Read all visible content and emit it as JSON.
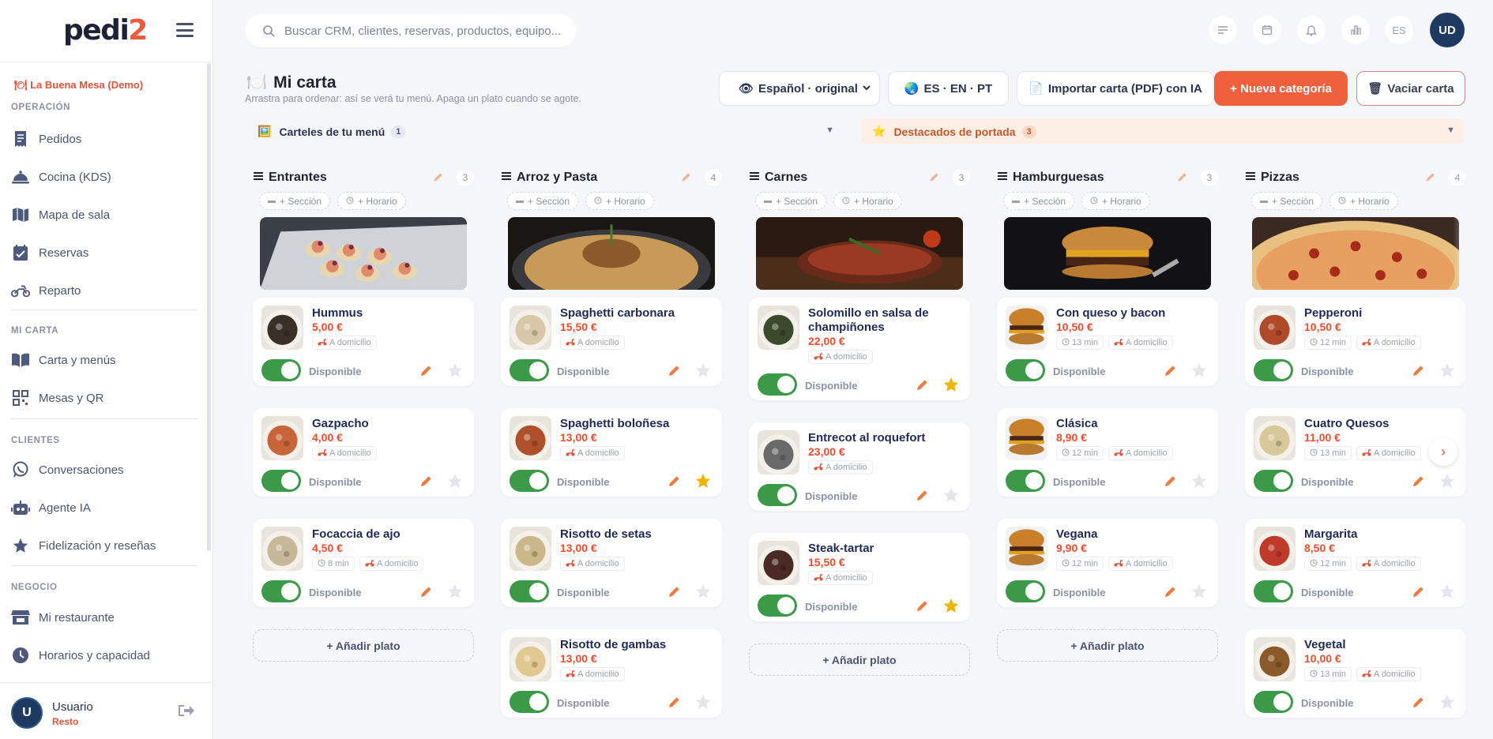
{
  "app": {
    "logo_main": "pedi",
    "logo_accent": "2"
  },
  "sidebar": {
    "brand": "La Buena Mesa (Demo)",
    "sections": [
      {
        "title": "OPERACIÓN",
        "items": [
          {
            "label": "Pedidos",
            "icon": "receipt-icon"
          },
          {
            "label": "Cocina (KDS)",
            "icon": "cloche-icon"
          },
          {
            "label": "Mapa de sala",
            "icon": "map-icon"
          },
          {
            "label": "Reservas",
            "icon": "calendar-check-icon"
          },
          {
            "label": "Reparto",
            "icon": "motorcycle-icon"
          }
        ]
      },
      {
        "title": "MI CARTA",
        "items": [
          {
            "label": "Carta y menús",
            "icon": "book-open-icon"
          },
          {
            "label": "Mesas y QR",
            "icon": "qr-icon"
          }
        ]
      },
      {
        "title": "CLIENTES",
        "items": [
          {
            "label": "Conversaciones",
            "icon": "whatsapp-icon"
          },
          {
            "label": "Agente IA",
            "icon": "robot-icon"
          },
          {
            "label": "Fidelización y reseñas",
            "icon": "star-icon"
          }
        ]
      },
      {
        "title": "NEGOCIO",
        "items": [
          {
            "label": "Mi restaurante",
            "icon": "store-icon"
          },
          {
            "label": "Horarios y capacidad",
            "icon": "clock-icon"
          }
        ]
      }
    ],
    "user": {
      "initial": "U",
      "name": "Usuario",
      "role": "Resto"
    }
  },
  "topbar": {
    "search_placeholder": "Buscar CRM, clientes, reservas, productos, equipo...",
    "lang": "ES",
    "avatar": "UD"
  },
  "page": {
    "title": "Mi carta",
    "subtitle": "Arrastra para ordenar: así se verá tu menú. Apaga un plato cuando se agote.",
    "language_select": "Español · original",
    "languages_btn": "ES · EN · PT",
    "import_btn": "Importar carta (PDF) con IA",
    "new_category_btn": "+ Nueva categoría",
    "empty_btn": "Vaciar carta",
    "banners_label": "Carteles de tu menú",
    "banners_count": "1",
    "featured_label": "Destacados de portada",
    "featured_count": "3"
  },
  "labels": {
    "section_chip": "+ Sección",
    "schedule_chip": "+ Horario",
    "delivery": "A domicilio",
    "available": "Disponible",
    "add_dish": "+ Añadir plato"
  },
  "columns": [
    {
      "name": "Entrantes",
      "count": "3",
      "dishes": [
        {
          "name": "Hummus",
          "price": "5,00 €",
          "time": "",
          "starred": false
        },
        {
          "name": "Gazpacho",
          "price": "4,00 €",
          "time": "",
          "starred": false
        },
        {
          "name": "Focaccia de ajo",
          "price": "4,50 €",
          "time": "8 min",
          "starred": false
        }
      ]
    },
    {
      "name": "Arroz y Pasta",
      "count": "4",
      "dishes": [
        {
          "name": "Spaghetti carbonara",
          "price": "15,50 €",
          "time": "",
          "starred": false
        },
        {
          "name": "Spaghetti boloñesa",
          "price": "13,00 €",
          "time": "",
          "starred": true
        },
        {
          "name": "Risotto de setas",
          "price": "13,00 €",
          "time": "",
          "starred": false
        },
        {
          "name": "Risotto de gambas",
          "price": "13,00 €",
          "time": "",
          "starred": false
        }
      ]
    },
    {
      "name": "Carnes",
      "count": "3",
      "dishes": [
        {
          "name": "Solomillo en salsa de champiñones",
          "price": "22,00 €",
          "time": "",
          "starred": true
        },
        {
          "name": "Entrecot al roquefort",
          "price": "23,00 €",
          "time": "",
          "starred": false
        },
        {
          "name": "Steak-tartar",
          "price": "15,50 €",
          "time": "",
          "starred": true
        }
      ]
    },
    {
      "name": "Hamburguesas",
      "count": "3",
      "dishes": [
        {
          "name": "Con queso y bacon",
          "price": "10,50 €",
          "time": "13 min",
          "starred": false
        },
        {
          "name": "Clásica",
          "price": "8,90 €",
          "time": "12 min",
          "starred": false
        },
        {
          "name": "Vegana",
          "price": "9,90 €",
          "time": "12 min",
          "starred": false
        }
      ]
    },
    {
      "name": "Pizzas",
      "count": "4",
      "dishes": [
        {
          "name": "Pepperoni",
          "price": "10,50 €",
          "time": "12 min",
          "starred": false
        },
        {
          "name": "Cuatro Quesos",
          "price": "11,00 €",
          "time": "13 min",
          "starred": false
        },
        {
          "name": "Margarita",
          "price": "8,50 €",
          "time": "12 min",
          "starred": false
        },
        {
          "name": "Vegetal",
          "price": "10,00 €",
          "time": "13 min",
          "starred": false
        }
      ]
    }
  ],
  "colors": {
    "accent": "#f0603c",
    "price": "#ee4e2e",
    "toggle_on": "#3a9a47",
    "star_on": "#f0b400"
  }
}
